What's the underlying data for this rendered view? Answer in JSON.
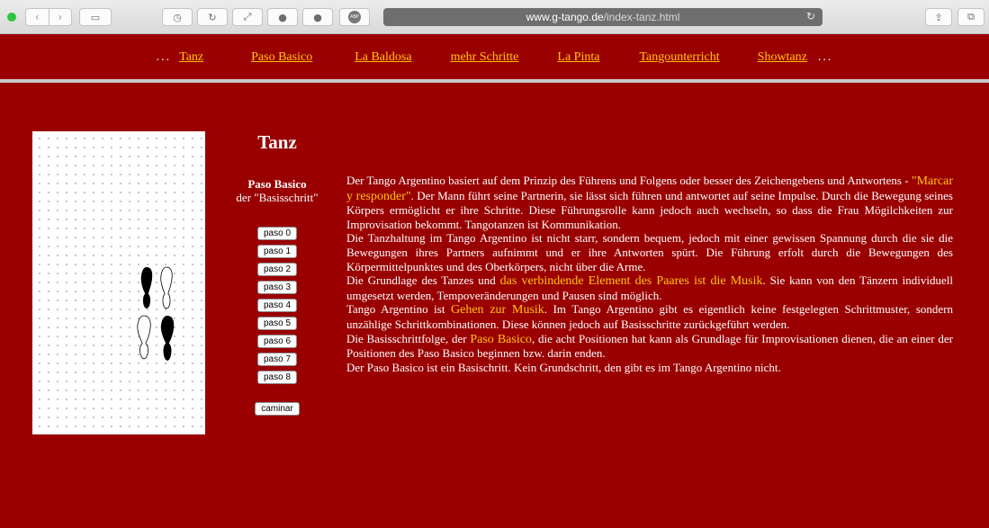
{
  "browser": {
    "url_host": "www.g-tango.de",
    "url_path": "/index-tanz.html",
    "adblock_label": "ABP"
  },
  "nav": {
    "items": [
      "Tanz",
      "Paso Basico",
      "La Baldosa",
      "mehr Schritte",
      "La Pinta",
      "Tangounterricht",
      "Showtanz"
    ],
    "ellipsis": "..."
  },
  "sidebar": {
    "title": "Tanz",
    "subtitle": "Paso Basico",
    "subtitle2": "der \"Basisschritt\"",
    "buttons": [
      "paso 0",
      "paso 1",
      "paso 2",
      "paso 3",
      "paso 4",
      "paso 5",
      "paso 6",
      "paso 7",
      "paso 8"
    ],
    "caminar": "caminar"
  },
  "content": {
    "p1a": "Der Tango Argentino basiert auf dem Prinzip des Führens und Folgens oder besser des Zeichengebens und Antwortens - ",
    "p1hl": "\"Marcar y responder\"",
    "p1b": ". Der Mann führt seine Partnerin, sie lässt sich führen und antwortet auf seine Impulse. Durch die Bewegung seines Körpers ermöglicht er ihre Schritte. Diese Führungsrolle kann jedoch auch wechseln, so dass die Frau Mögilchkeiten zur Improvisation bekommt. Tangotanzen ist Kommunikation.",
    "p2": "Die Tanzhaltung im Tango Argentino ist nicht starr, sondern bequem, jedoch mit einer gewissen Spannung durch die sie die Bewegungen ihres Partners aufnimmt und er ihre Antworten spürt. Die Führung erfolt durch die Bewegungen des Körpermittelpunktes und des Oberkörpers, nicht über die Arme.",
    "p3a": "Die Grundlage des Tanzes und ",
    "p3hl": "das verbindende Element des Paares ist die Musik",
    "p3b": ". Sie kann von den Tänzern individuell umgesetzt werden, Tempoveränderungen und Pausen sind möglich.",
    "p4a": "Tango Argentino ist ",
    "p4hl": "Gehen zur Musik",
    "p4b": ". Im Tango Argentino gibt es eigentlich keine festgelegten Schrittmuster, sondern unzählige Schrittkombinationen. Diese können jedoch auf Basisschritte zurückgeführt werden.",
    "p5a": "Die Basisschrittfolge, der ",
    "p5hl": "Paso Basico",
    "p5b": ", die acht Positionen hat kann als Grundlage für Improvisationen dienen, die an einer der Positionen des Paso Basico beginnen bzw. darin enden.",
    "p6": "Der Paso Basico ist ein Basischritt. Kein Grundschritt, den gibt es im Tango Argentino nicht."
  },
  "colors": {
    "background": "#9a0000",
    "link": "#ffc40c",
    "highlight": "#ffc40c",
    "text": "#ffffff"
  }
}
